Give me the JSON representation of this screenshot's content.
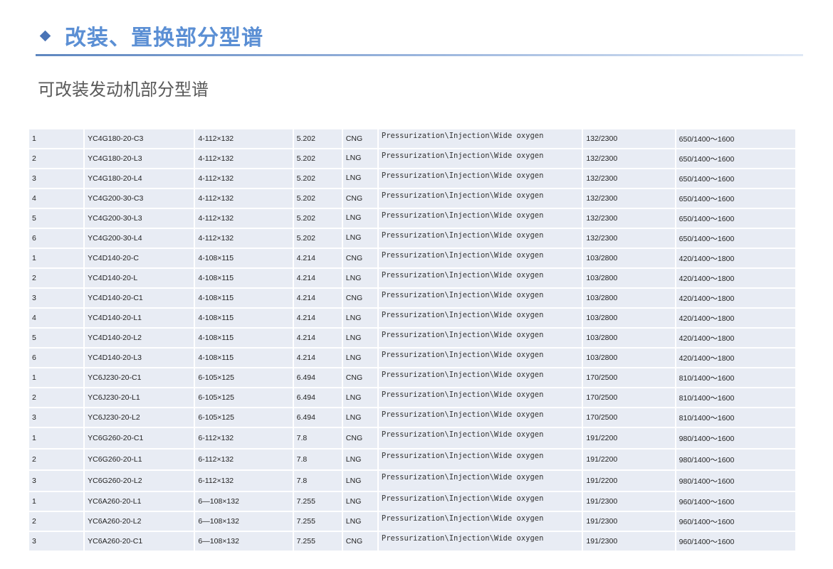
{
  "title": "改装、置换部分型谱",
  "subtitle": "可改装发动机部分型谱",
  "rows": [
    [
      "1",
      "YC4G180-20-C3",
      "4-112×132",
      "5.202",
      "CNG",
      "Pressurization\\Injection\\Wide oxygen",
      "132/2300",
      "650/1400～1600"
    ],
    [
      "2",
      "YC4G180-20-L3",
      "4-112×132",
      "5.202",
      "LNG",
      "Pressurization\\Injection\\Wide oxygen",
      "132/2300",
      "650/1400～1600"
    ],
    [
      "3",
      "YC4G180-20-L4",
      "4-112×132",
      "5.202",
      "LNG",
      "Pressurization\\Injection\\Wide oxygen",
      "132/2300",
      "650/1400～1600"
    ],
    [
      "4",
      "YC4G200-30-C3",
      "4-112×132",
      "5.202",
      "CNG",
      "Pressurization\\Injection\\Wide oxygen",
      "132/2300",
      "650/1400～1600"
    ],
    [
      "5",
      "YC4G200-30-L3",
      "4-112×132",
      "5.202",
      "LNG",
      "Pressurization\\Injection\\Wide oxygen",
      "132/2300",
      "650/1400～1600"
    ],
    [
      "6",
      "YC4G200-30-L4",
      "4-112×132",
      "5.202",
      "LNG",
      "Pressurization\\Injection\\Wide oxygen",
      "132/2300",
      "650/1400～1600"
    ],
    [
      "1",
      "YC4D140-20-C",
      "4-108×115",
      "4.214",
      "CNG",
      "Pressurization\\Injection\\Wide oxygen",
      "103/2800",
      "420/1400～1800"
    ],
    [
      "2",
      "YC4D140-20-L",
      "4-108×115",
      "4.214",
      "LNG",
      "Pressurization\\Injection\\Wide oxygen",
      "103/2800",
      "420/1400～1800"
    ],
    [
      "3",
      "YC4D140-20-C1",
      "4-108×115",
      "4.214",
      "CNG",
      "Pressurization\\Injection\\Wide oxygen",
      "103/2800",
      "420/1400～1800"
    ],
    [
      "4",
      "YC4D140-20-L1",
      "4-108×115",
      "4.214",
      "LNG",
      "Pressurization\\Injection\\Wide oxygen",
      "103/2800",
      "420/1400～1800"
    ],
    [
      "5",
      "YC4D140-20-L2",
      "4-108×115",
      "4.214",
      "LNG",
      "Pressurization\\Injection\\Wide oxygen",
      "103/2800",
      "420/1400～1800"
    ],
    [
      "6",
      "YC4D140-20-L3",
      "4-108×115",
      "4.214",
      "LNG",
      "Pressurization\\Injection\\Wide oxygen",
      "103/2800",
      "420/1400～1800"
    ],
    [
      "1",
      "YC6J230-20-C1",
      "6-105×125",
      "6.494",
      "CNG",
      "Pressurization\\Injection\\Wide oxygen",
      "170/2500",
      "810/1400～1600"
    ],
    [
      "2",
      "YC6J230-20-L1",
      "6-105×125",
      "6.494",
      "LNG",
      "Pressurization\\Injection\\Wide oxygen",
      "170/2500",
      "810/1400～1600"
    ],
    [
      "3",
      "YC6J230-20-L2",
      "6-105×125",
      "6.494",
      "LNG",
      "Pressurization\\Injection\\Wide oxygen",
      "170/2500",
      "810/1400～1600"
    ],
    [
      "1",
      "YC6G260-20-C1",
      "6-112×132",
      "7.8",
      "CNG",
      "Pressurization\\Injection\\Wide oxygen",
      "191/2200",
      "980/1400～1600"
    ],
    [
      "2",
      "YC6G260-20-L1",
      "6-112×132",
      "7.8",
      "LNG",
      "Pressurization\\Injection\\Wide oxygen",
      "191/2200",
      "980/1400～1600"
    ],
    [
      "3",
      "YC6G260-20-L2",
      "6-112×132",
      "7.8",
      "LNG",
      "Pressurization\\Injection\\Wide oxygen",
      "191/2200",
      "980/1400～1600"
    ],
    [
      "1",
      "YC6A260-20-L1",
      "6—108×132",
      "7.255",
      "LNG",
      "Pressurization\\Injection\\Wide oxygen",
      "191/2300",
      "960/1400～1600"
    ],
    [
      "2",
      "YC6A260-20-L2",
      "6—108×132",
      "7.255",
      "LNG",
      "Pressurization\\Injection\\Wide oxygen",
      "191/2300",
      "960/1400～1600"
    ],
    [
      "3",
      "YC6A260-20-C1",
      "6—108×132",
      "7.255",
      "CNG",
      "Pressurization\\Injection\\Wide oxygen",
      "191/2300",
      "960/1400～1600"
    ]
  ]
}
